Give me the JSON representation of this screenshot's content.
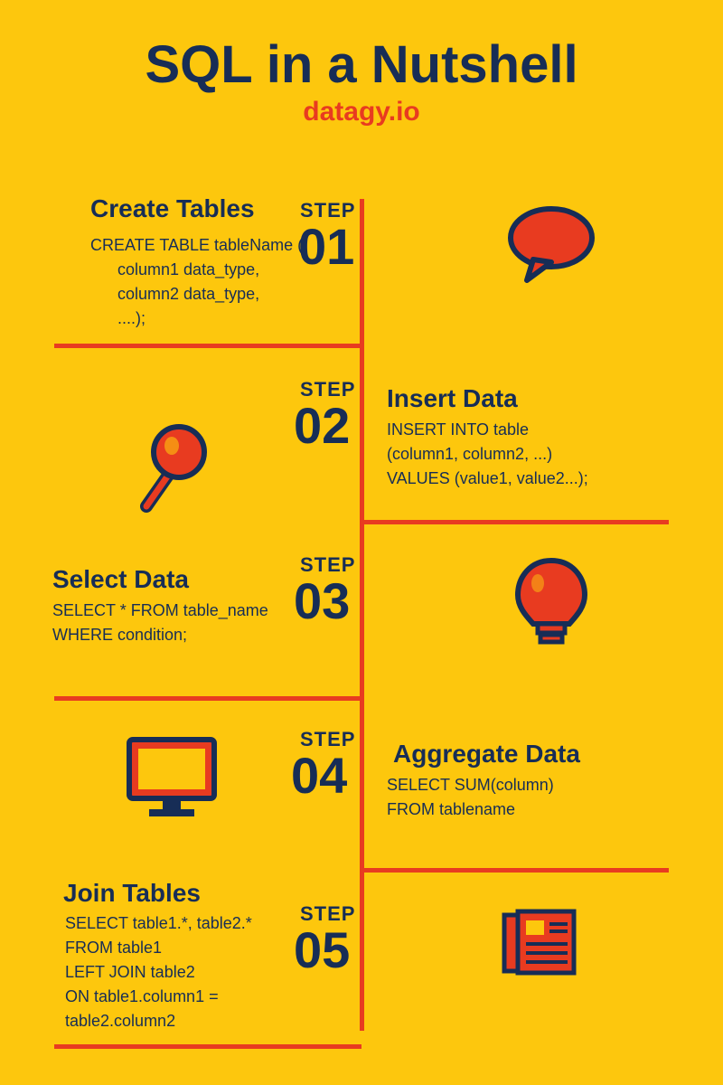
{
  "title": "SQL in a Nutshell",
  "subtitle": "datagy.io",
  "steps": {
    "s1": {
      "label": "STEP",
      "num": "01",
      "title": "Create  Tables",
      "code": "CREATE TABLE tableName (\n      column1 data_type,\n      column2 data_type,\n      ....);"
    },
    "s2": {
      "label": "STEP",
      "num": "02",
      "title": "Insert Data",
      "code": "INSERT INTO table\n(column1, column2, ...)\nVALUES (value1, value2...);"
    },
    "s3": {
      "label": "STEP",
      "num": "03",
      "title": "Select Data",
      "code": "SELECT * FROM table_name\nWHERE condition;"
    },
    "s4": {
      "label": "STEP",
      "num": "04",
      "title": "Aggregate Data",
      "code": "SELECT SUM(column)\nFROM tablename"
    },
    "s5": {
      "label": "STEP",
      "num": "05",
      "title": "Join Tables",
      "code": "SELECT table1.*, table2.*\nFROM table1\nLEFT JOIN table2\nON table1.column1 =\ntable2.column2"
    }
  }
}
